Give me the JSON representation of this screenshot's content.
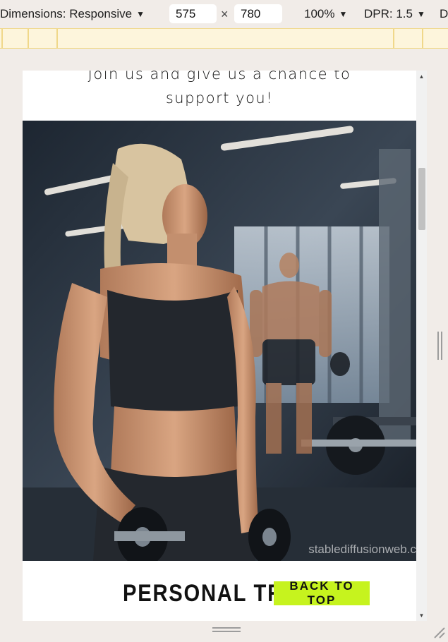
{
  "toolbar": {
    "dimensions_label": "Dimensions: Responsive",
    "width_value": "575",
    "times": "×",
    "height_value": "780",
    "zoom": "100%",
    "dpr": "DPR: 1.5",
    "overflow_label": "D"
  },
  "page": {
    "intro_line1": "Join us and give us a chance to",
    "intro_line2": "support you!",
    "watermark": "stablediffusionweb.c",
    "section_title": "PERSONAL TRAI",
    "back_to_top": "BACK TO TOP"
  },
  "colors": {
    "accent": "#c6f31e",
    "devtools_bg": "#f1ece8",
    "media_query_bar": "#fdf5dc"
  },
  "icons": {
    "dropdown": "caret-down-icon",
    "scroll_up": "triangle-up-icon",
    "scroll_down": "triangle-down-icon",
    "resize": "resize-grip-icon"
  }
}
